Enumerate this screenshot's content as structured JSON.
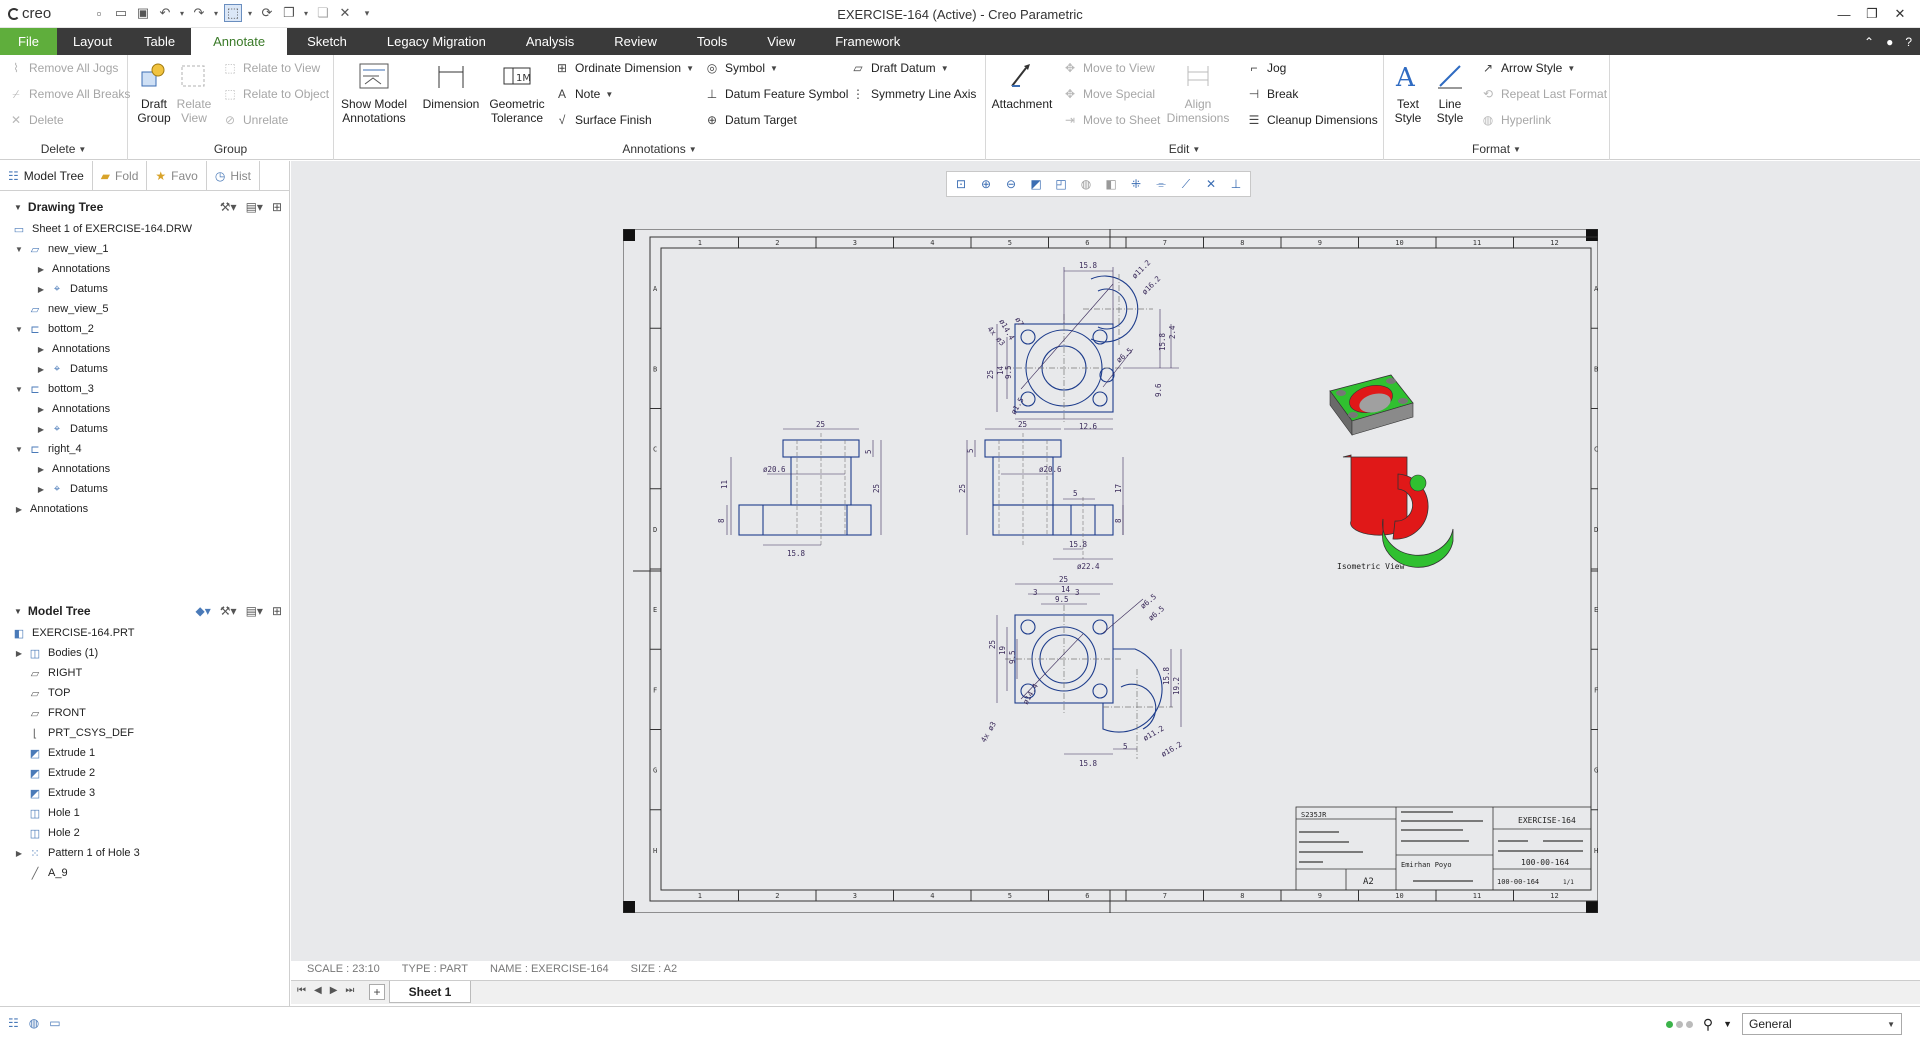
{
  "app": {
    "logo": "creo",
    "title": "EXERCISE-164 (Active) - Creo Parametric"
  },
  "menu": [
    "File",
    "Layout",
    "Table",
    "Annotate",
    "Sketch",
    "Legacy Migration",
    "Analysis",
    "Review",
    "Tools",
    "View",
    "Framework"
  ],
  "ribbon": {
    "delete": {
      "items": [
        "Remove All Jogs",
        "Remove All Breaks",
        "Delete"
      ],
      "label": "Delete"
    },
    "group": {
      "draft_group": "Draft\nGroup",
      "relate_view": "Relate\nView",
      "relate_to_view": "Relate to View",
      "relate_to_object": "Relate to Object",
      "unrelate": "Unrelate",
      "label": "Group"
    },
    "annotations": {
      "show_model": "Show Model\nAnnotations",
      "dimension": "Dimension",
      "geom_tol": "Geometric\nTolerance",
      "ordinate": "Ordinate Dimension",
      "note": "Note",
      "surface_finish": "Surface Finish",
      "symbol": "Symbol",
      "datum_feature": "Datum Feature Symbol",
      "datum_target": "Datum Target",
      "draft_datum": "Draft Datum",
      "symmetry": "Symmetry Line Axis",
      "label": "Annotations"
    },
    "edit": {
      "attachment": "Attachment",
      "move_view": "Move to View",
      "move_special": "Move Special",
      "move_sheet": "Move to Sheet",
      "align": "Align\nDimensions",
      "jog": "Jog",
      "break": "Break",
      "cleanup": "Cleanup Dimensions",
      "label": "Edit"
    },
    "format": {
      "text_style": "Text\nStyle",
      "line_style": "Line\nStyle",
      "arrow_style": "Arrow Style",
      "repeat_last": "Repeat Last Format",
      "hyperlink": "Hyperlink",
      "label": "Format"
    }
  },
  "panel": {
    "tabs": [
      "Model Tree",
      "Fold",
      "Favo",
      "Hist"
    ]
  },
  "drawing_tree": {
    "title": "Drawing Tree",
    "items": [
      "Sheet 1 of EXERCISE-164.DRW",
      "new_view_1",
      "Annotations",
      "Datums",
      "new_view_5",
      "bottom_2",
      "Annotations",
      "Datums",
      "bottom_3",
      "Annotations",
      "Datums",
      "right_4",
      "Annotations",
      "Datums",
      "Annotations"
    ]
  },
  "model_tree": {
    "title": "Model Tree",
    "items": [
      "EXERCISE-164.PRT",
      "Bodies (1)",
      "RIGHT",
      "TOP",
      "FRONT",
      "PRT_CSYS_DEF",
      "Extrude 1",
      "Extrude 2",
      "Extrude 3",
      "Hole 1",
      "Hole 2",
      "Pattern 1 of Hole 3",
      "A_9"
    ]
  },
  "drawing": {
    "dims_top": [
      "15.8",
      "ø11.2",
      "ø16.2",
      "4x ø3",
      "ø14.4",
      "ø7",
      "15.8",
      "2.4",
      "9.5",
      "14",
      "25",
      "ø6.5",
      "9.6",
      "ø1.5",
      "12.6"
    ],
    "dims_front": [
      "25",
      "5",
      "ø20.6",
      "11",
      "25",
      "8",
      "15.8"
    ],
    "dims_side": [
      "25",
      "5",
      "ø20.6",
      "25",
      "17",
      "5",
      "15.8",
      "8",
      "ø22.4"
    ],
    "dims_bottom": [
      "25",
      "14",
      "3",
      "9.5",
      "3",
      "ø6.5",
      "ø6.5",
      "25",
      "19",
      "9.5",
      "15.8",
      "19.2",
      "4x ø3",
      "ø14.4",
      "ø11.2",
      "ø16.2",
      "15.8",
      "5"
    ],
    "iso_label": "Isometric View",
    "zones_h": [
      "1",
      "2",
      "3",
      "4",
      "5",
      "6",
      "7",
      "8",
      "9",
      "10",
      "11",
      "12"
    ],
    "zones_v": [
      "A",
      "B",
      "C",
      "D",
      "E",
      "F",
      "G",
      "H"
    ],
    "title_block": {
      "part": "EXERCISE-164",
      "number": "100-00-164",
      "size": "A2",
      "material": "S235JR",
      "author": "Emirhan Poyo",
      "drawing_no": "100-00-164",
      "sheet": "1/1"
    }
  },
  "status": {
    "scale": "SCALE : 23:10",
    "type": "TYPE : PART",
    "name": "NAME : EXERCISE-164",
    "size": "SIZE : A2"
  },
  "sheet_tab": "Sheet 1",
  "filter": "General",
  "colors": {
    "menubar": "#3a3a3a",
    "file": "#5fae3c",
    "active_tab": "#3a7a28",
    "drawing_line": "#1e3d8c",
    "dimension": "#3a2a5a",
    "iso_green": "#30c030",
    "iso_red": "#e01818"
  }
}
